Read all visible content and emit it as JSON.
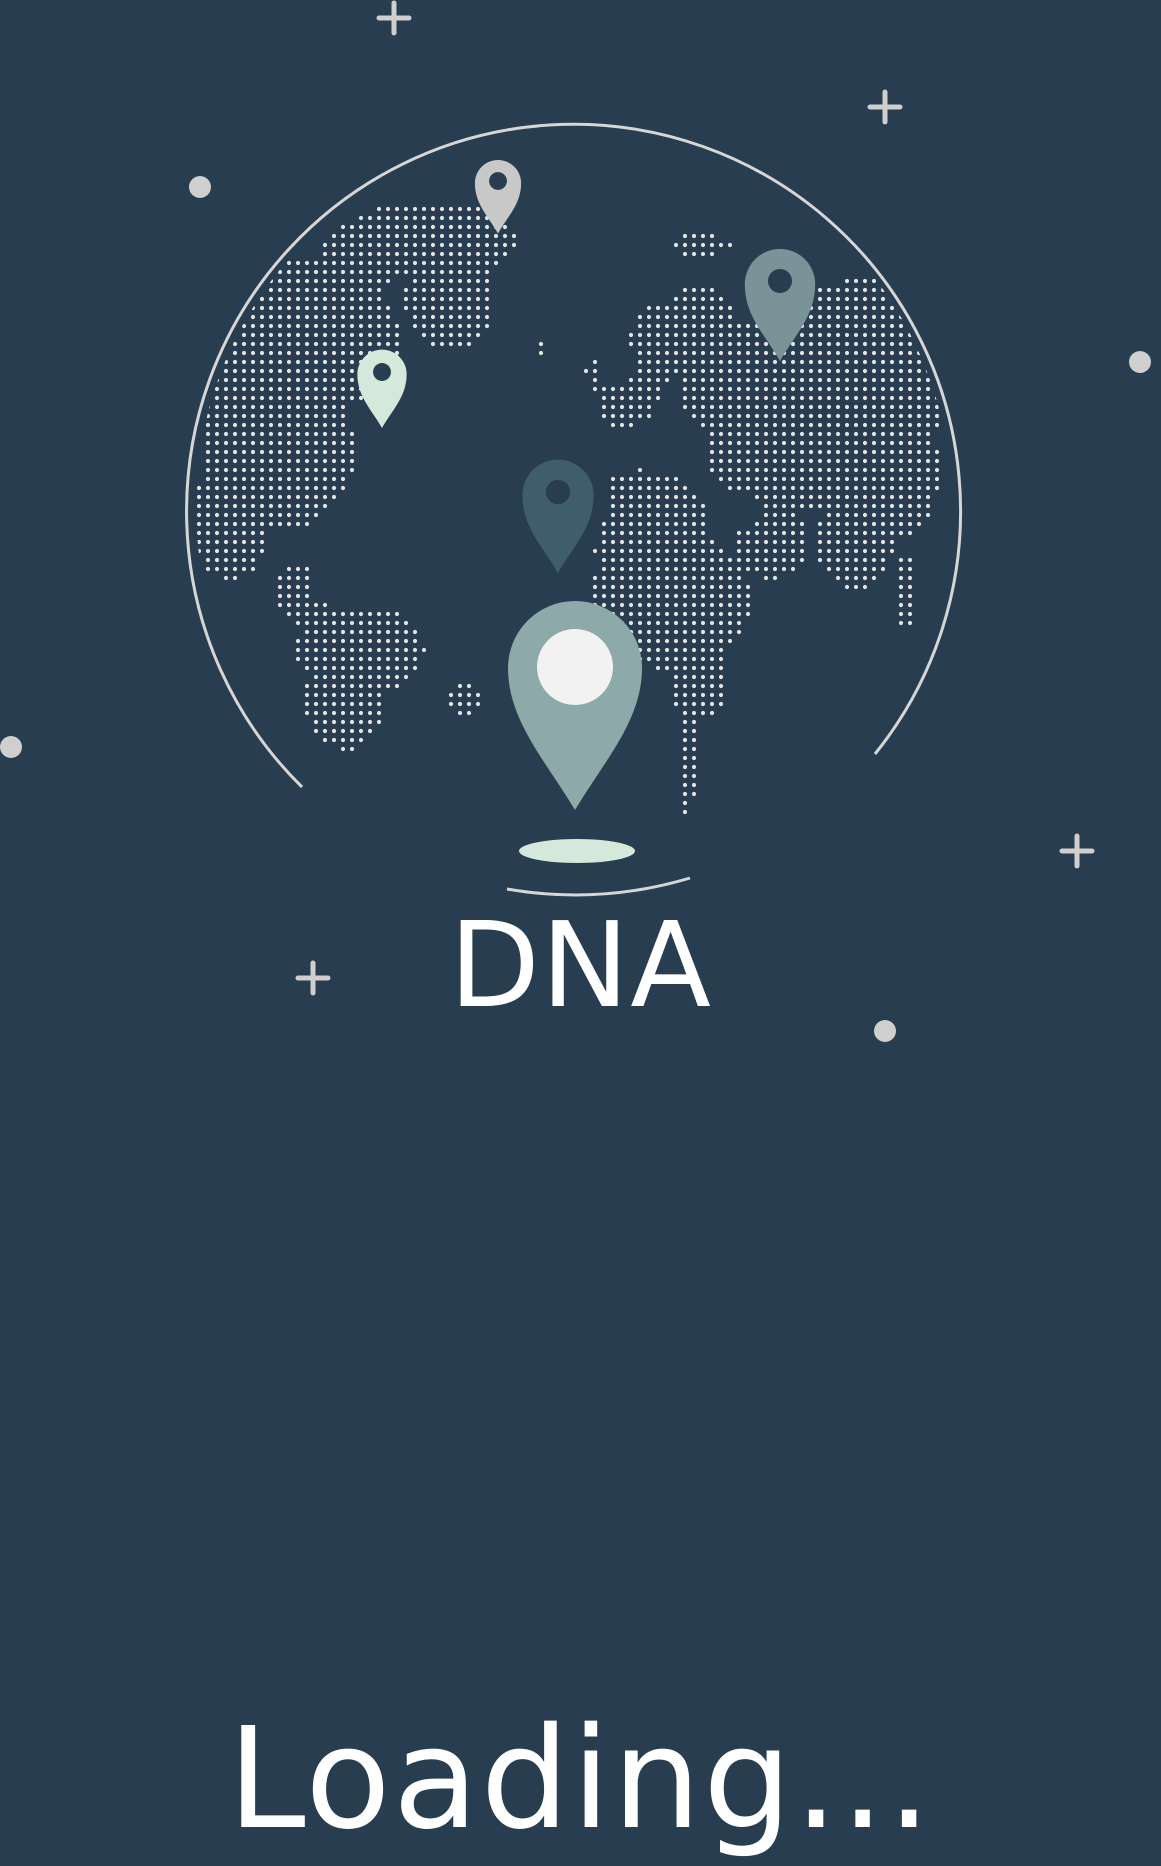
{
  "app": {
    "title": "DNA",
    "status_text": "Loading..."
  },
  "theme": {
    "background": "#283d4f",
    "text": "#ffffff",
    "decor": "#cfcfcf",
    "dots": "#e3e3e3",
    "pin_main": "#8da9a9",
    "pin_main_center": "#f2f2f2",
    "pin_shadow": "#d4e8dc",
    "pin_north": "#c8c8c8",
    "pin_america": "#d4e8dc",
    "pin_asia": "#7a9398",
    "pin_africa": "#3f5d6d"
  },
  "illustration": {
    "globe": "world-map-dotted",
    "pins": [
      "location-pin-icon",
      "location-pin-icon",
      "location-pin-icon",
      "location-pin-icon",
      "location-pin-icon"
    ],
    "decorations": [
      "plus-icon",
      "dot-icon"
    ]
  }
}
